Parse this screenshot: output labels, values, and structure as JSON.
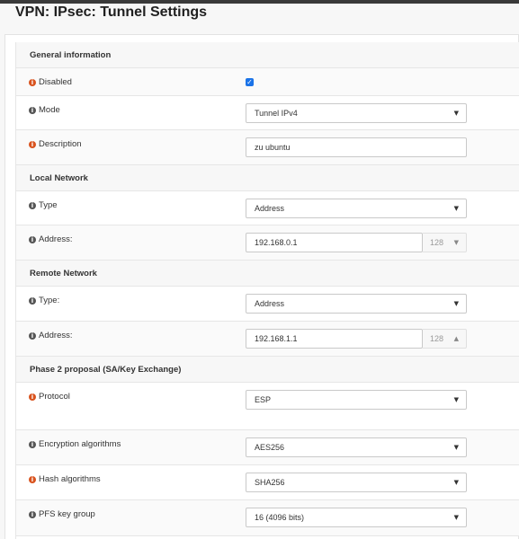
{
  "page": {
    "title": "VPN: IPsec: Tunnel Settings"
  },
  "icons": {
    "info": "i",
    "caret_down": "▼",
    "caret_up": "▲",
    "check": "✓"
  },
  "colors": {
    "warning_icon": "#d9531e",
    "info_icon": "#555555",
    "checkbox": "#1a73e8"
  },
  "sections": {
    "general": "General information",
    "local": "Local Network",
    "remote": "Remote Network",
    "phase2": "Phase 2 proposal (SA/Key Exchange)"
  },
  "fields": {
    "disabled": {
      "label": "Disabled",
      "checked": true
    },
    "mode": {
      "label": "Mode",
      "value": "Tunnel IPv4"
    },
    "description": {
      "label": "Description",
      "value": "zu ubuntu"
    },
    "local_type": {
      "label": "Type",
      "value": "Address"
    },
    "local_address": {
      "label": "Address:",
      "value": "192.168.0.1",
      "mask": "128"
    },
    "remote_type": {
      "label": "Type:",
      "value": "Address"
    },
    "remote_address": {
      "label": "Address:",
      "value": "192.168.1.1",
      "mask": "128"
    },
    "protocol": {
      "label": "Protocol",
      "value": "ESP"
    },
    "encryption": {
      "label": "Encryption algorithms",
      "value": "AES256"
    },
    "hash": {
      "label": "Hash algorithms",
      "value": "SHA256"
    },
    "pfs": {
      "label": "PFS key group",
      "value": "16 (4096 bits)"
    }
  }
}
